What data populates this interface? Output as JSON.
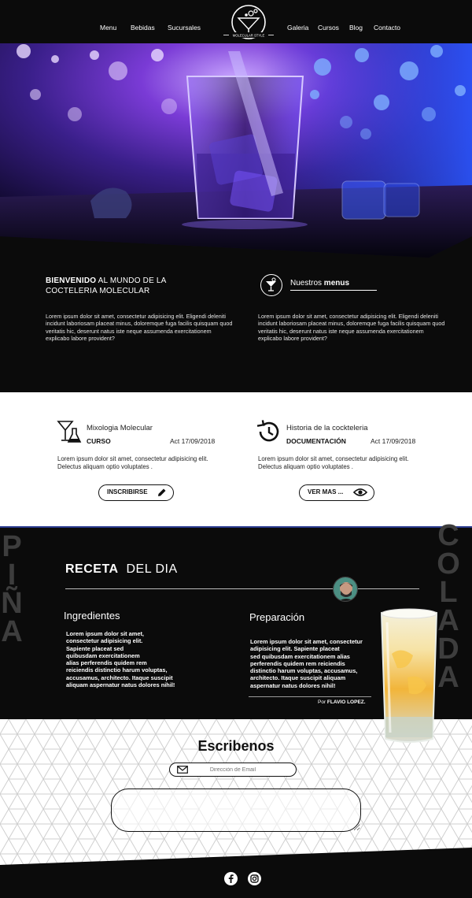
{
  "nav": {
    "left": [
      "Menu",
      "Bebidas",
      "Sucursales"
    ],
    "right": [
      "Galeria",
      "Cursos",
      "Blog",
      "Contacto"
    ],
    "logo_text": "MOLECULAR STYLE"
  },
  "welcome": {
    "title_bold": "BIENVENIDO",
    "title_rest": " AL MUNDO DE LA",
    "title_line2": "COCTELERIA MOLECULAR",
    "text_left": "Lorem ipsum dolor sit amet, consectetur adipisicing elit. Eligendi deleniti incidunt laboriosam placeat minus, doloremque fuga facilis quisquam quod veritatis hic, deserunt natus iste neque assumenda exercitationem explicabo labore provident?",
    "menu_label_prefix": "Nuestros ",
    "menu_label_bold": "menus",
    "text_right": "Lorem ipsum dolor sit amet, consectetur adipisicing elit. Eligendi deleniti incidunt laboriosam placeat minus, doloremque fuga facilis quisquam quod veritatis hic, deserunt natus iste neque assumenda exercitationem explicabo labore provident?"
  },
  "courses": [
    {
      "title": "Mixologia Molecular",
      "tag": "CURSO",
      "date": "Act 17/09/2018",
      "text": "Lorem ipsum dolor sit amet, consectetur  adipisicing elit. Delectus aliquam optio voluptates .",
      "button": "INSCRIBIRSE",
      "icon": "cocktail-flask-icon"
    },
    {
      "title": "Historia de la cockteleria",
      "tag": "DOCUMENTACIÓN",
      "date": "Act 17/09/2018",
      "text": "Lorem ipsum dolor sit amet, consectetur  adipisicing elit. Delectus aliquam optio voluptates .",
      "button": "VER MAS ...",
      "icon": "history-icon"
    }
  ],
  "recipe": {
    "side_left": [
      "P",
      "I",
      "Ñ",
      "A"
    ],
    "side_right": [
      "C",
      "O",
      "L",
      "A",
      "D",
      "A"
    ],
    "title_bold": "RECETA",
    "title_rest": "  DEL DIA",
    "ingredients_heading": "Ingredientes",
    "ingredients_text": [
      "Lorem ipsum dolor sit amet,",
      "consectetur adipisicing elit.",
      "Sapiente placeat sed",
      "quibusdam exercitationem",
      "alias perferendis quidem rem",
      "reiciendis distinctio harum voluptas,",
      "accusamus, architecto. Itaque suscipit",
      "aliquam aspernatur natus dolores nihil!"
    ],
    "preparation_heading": "Preparación",
    "preparation_text": [
      "Lorem ipsum dolor sit amet, consectetur",
      "adipisicing elit. Sapiente placeat",
      "sed quibusdam exercitationem alias",
      "perferendis quidem rem reiciendis",
      "distinctio harum voluptas, accusamus,",
      "architecto. Itaque suscipit aliquam",
      "aspernatur natus dolores nihil!"
    ],
    "author_prefix": "Por ",
    "author": "FLAVIO LOPEZ."
  },
  "contact": {
    "title": "Escribenos",
    "email_placeholder": "Dirección de Email"
  },
  "footer": {
    "social": [
      "facebook-icon",
      "instagram-icon"
    ]
  }
}
